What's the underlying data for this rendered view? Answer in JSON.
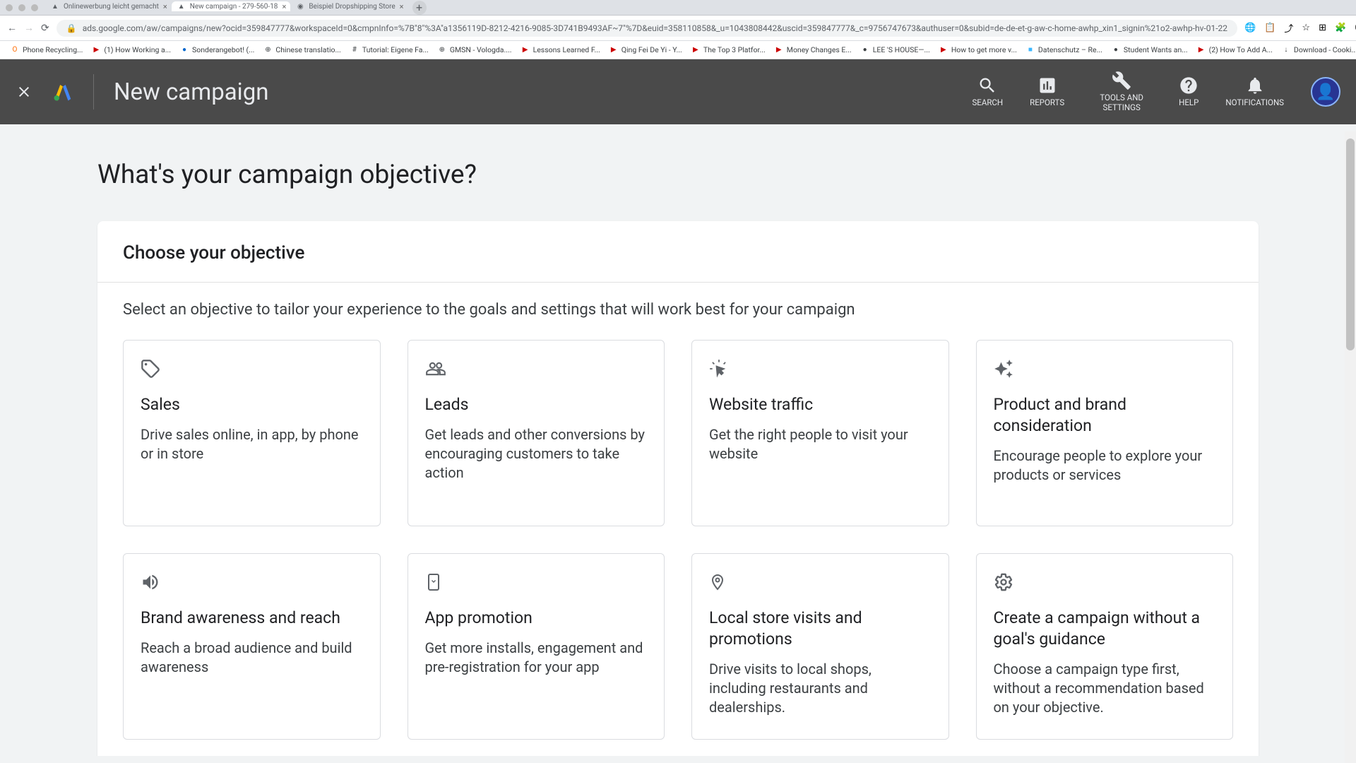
{
  "browser": {
    "tabs": [
      {
        "title": "Onlinewerbung leicht gemacht",
        "active": false,
        "favicon": "▲"
      },
      {
        "title": "New campaign - 279-560-18",
        "active": true,
        "favicon": "▲"
      },
      {
        "title": "Beispiel Dropshipping Store",
        "active": false,
        "favicon": "◉"
      }
    ],
    "url": "ads.google.com/aw/campaigns/new?ocid=359847777&workspaceId=0&cmpnInfo=%7B\"8\"%3A\"a1356119D-8212-4216-9085-3D741B9493AF~7\"%7D&euid=358110858&_u=1043808442&uscid=359847777&_c=9756747673&authuser=0&subid=de-de-et-g-aw-c-home-awhp_xin1_signin%21o2-awhp-hv-01-22",
    "bookmarks": [
      {
        "label": "Phone Recycling...",
        "icon": "O",
        "color": "#ff6b00"
      },
      {
        "label": "(1) How Working a...",
        "icon": "▶",
        "color": "#cc0000"
      },
      {
        "label": "Sonderangebot! (...",
        "icon": "●",
        "color": "#0066cc"
      },
      {
        "label": "Chinese translatio...",
        "icon": "⊕",
        "color": "#555"
      },
      {
        "label": "Tutorial: Eigene Fa...",
        "icon": "#",
        "color": "#555"
      },
      {
        "label": "GMSN - Vologda....",
        "icon": "⊕",
        "color": "#555"
      },
      {
        "label": "Lessons Learned F...",
        "icon": "▶",
        "color": "#cc0000"
      },
      {
        "label": "Qing Fei De Yi - Y...",
        "icon": "▶",
        "color": "#cc0000"
      },
      {
        "label": "The Top 3 Platfor...",
        "icon": "▶",
        "color": "#cc0000"
      },
      {
        "label": "Money Changes E...",
        "icon": "▶",
        "color": "#cc0000"
      },
      {
        "label": "LEE 'S HOUSE—...",
        "icon": "●",
        "color": "#555"
      },
      {
        "label": "How to get more v...",
        "icon": "▶",
        "color": "#cc0000"
      },
      {
        "label": "Datenschutz – Re...",
        "icon": "■",
        "color": "#3ab6ff"
      },
      {
        "label": "Student Wants an...",
        "icon": "●",
        "color": "#555"
      },
      {
        "label": "(2) How To Add A...",
        "icon": "▶",
        "color": "#cc0000"
      },
      {
        "label": "Download - Cooki...",
        "icon": "↓",
        "color": "#555"
      }
    ]
  },
  "header": {
    "title": "New campaign",
    "actions": [
      {
        "id": "search",
        "label": "SEARCH"
      },
      {
        "id": "reports",
        "label": "REPORTS"
      },
      {
        "id": "tools",
        "label": "TOOLS AND SETTINGS"
      },
      {
        "id": "help",
        "label": "HELP"
      },
      {
        "id": "notifications",
        "label": "NOTIFICATIONS"
      }
    ]
  },
  "main": {
    "question": "What's your campaign objective?",
    "card_title": "Choose your objective",
    "subtitle": "Select an objective to tailor your experience to the goals and settings that will work best for your campaign",
    "objectives": [
      {
        "id": "sales",
        "title": "Sales",
        "desc": "Drive sales online, in app, by phone or in store"
      },
      {
        "id": "leads",
        "title": "Leads",
        "desc": "Get leads and other conversions by encouraging customers to take action"
      },
      {
        "id": "traffic",
        "title": "Website traffic",
        "desc": "Get the right people to visit your website"
      },
      {
        "id": "brand",
        "title": "Product and brand consideration",
        "desc": "Encourage people to explore your products or services"
      },
      {
        "id": "awareness",
        "title": "Brand awareness and reach",
        "desc": "Reach a broad audience and build awareness"
      },
      {
        "id": "app",
        "title": "App promotion",
        "desc": "Get more installs, engagement and pre-registration for your app"
      },
      {
        "id": "local",
        "title": "Local store visits and promotions",
        "desc": "Drive visits to local shops, including restaurants and dealerships."
      },
      {
        "id": "nogoal",
        "title": "Create a campaign without a goal's guidance",
        "desc": "Choose a campaign type first, without a recommendation based on your objective."
      }
    ]
  }
}
